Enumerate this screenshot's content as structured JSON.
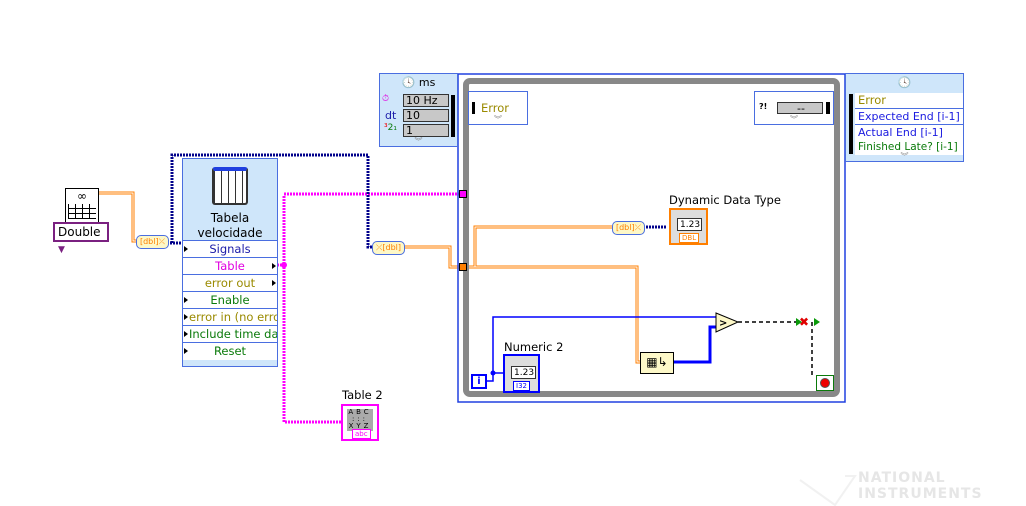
{
  "table_constant": {
    "ring_value": "Double",
    "icon": "glasses-table-icon"
  },
  "express_vi": {
    "title": "Tabela velocidade",
    "icon": "table-grid-icon",
    "terminals": [
      {
        "label": "Signals",
        "color": "#1a1aa8"
      },
      {
        "label": "Table",
        "color": "#e000e0"
      },
      {
        "label": "error out",
        "color": "#9a8a00"
      },
      {
        "label": "Enable",
        "color": "#0a7a0a"
      },
      {
        "label": "error in (no error)",
        "color": "#9a8a00"
      },
      {
        "label": "Include time data",
        "color": "#0a7a0a"
      },
      {
        "label": "Reset",
        "color": "#0a7a0a"
      }
    ]
  },
  "timed_loop": {
    "input_node": {
      "unit": "ms",
      "rows": [
        {
          "value": "10 Hz"
        },
        {
          "label": "dt",
          "value": "10"
        },
        {
          "value": "1"
        }
      ]
    },
    "left_data_node": {
      "label": "Error"
    },
    "right_data_node": {
      "value": "--"
    },
    "output_node": {
      "rows": [
        {
          "label": "Error",
          "color": "#9a8a00"
        },
        {
          "label": "Expected End [i-1]",
          "color": "#1a1ae0"
        },
        {
          "label": "Actual End [i-1]",
          "color": "#1a1ae0"
        },
        {
          "label": "Finished Late? [i-1]",
          "color": "#0a7a0a"
        }
      ]
    }
  },
  "indicators": {
    "dynamic": {
      "label": "Dynamic Data Type",
      "value": "1.23",
      "type": "DBL"
    },
    "numeric2": {
      "label": "Numeric 2",
      "value": "1.23",
      "type": "I32"
    },
    "table2": {
      "label": "Table 2",
      "type": "abc"
    }
  },
  "iteration_terminal": "i",
  "watermark": "NATIONAL INSTRUMENTS",
  "colors": {
    "table_wire": "#ff00ff",
    "dbl_wire": "#ff7f00",
    "dynamic_wire": "#00008b",
    "int_wire": "#0000ff",
    "bool_wire": "#006400"
  }
}
